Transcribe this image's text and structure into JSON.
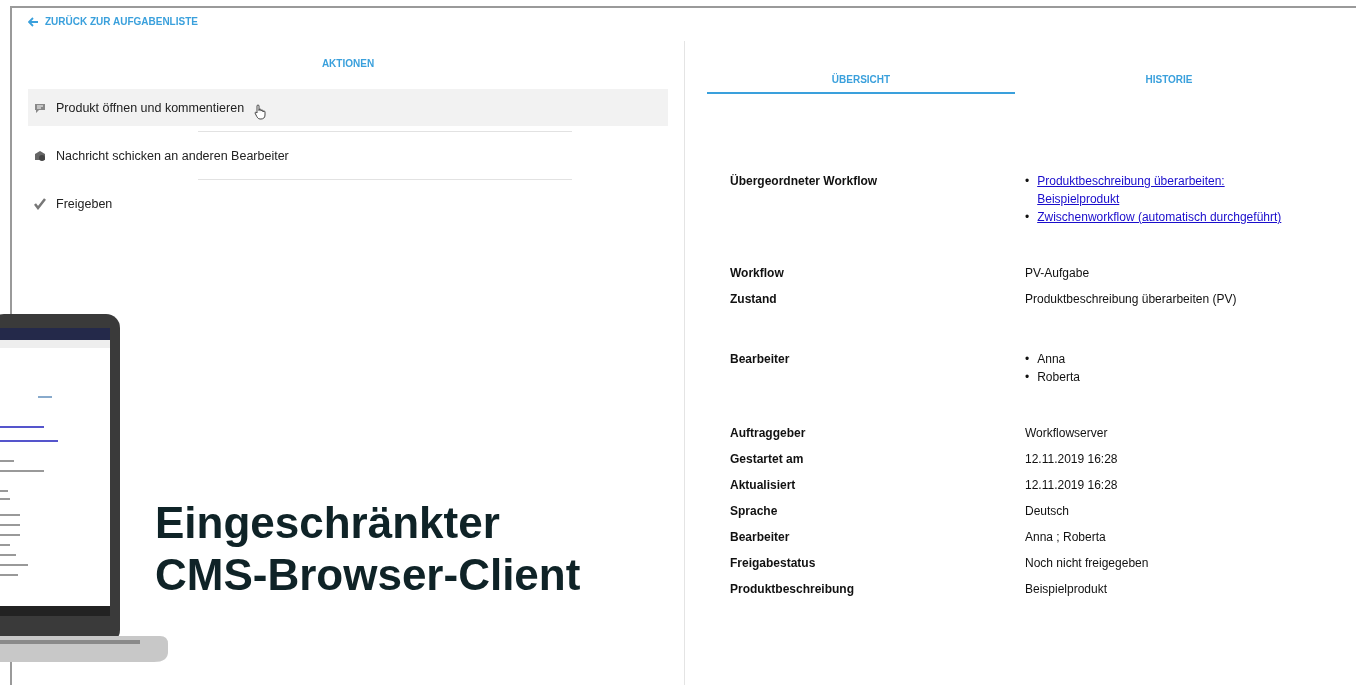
{
  "back_link": {
    "label": "ZURÜCK ZUR AUFGABENLISTE"
  },
  "actions": {
    "title": "AKTIONEN",
    "items": [
      {
        "label": "Produkt öffnen und kommentieren",
        "kind": "comment",
        "highlighted": true
      },
      {
        "label": "Nachricht schicken an anderen Bearbeiter",
        "kind": "message",
        "highlighted": false
      },
      {
        "label": "Freigeben",
        "kind": "approve",
        "highlighted": false
      }
    ]
  },
  "tabs": [
    {
      "label": "ÜBERSICHT",
      "selected": true
    },
    {
      "label": "HISTORIE",
      "selected": false
    }
  ],
  "details": [
    [
      {
        "label": "Übergeordneter Workflow",
        "items": [
          {
            "marker": "•",
            "text": "Produktbeschreibung überarbeiten: Beispielprodukt",
            "link": true
          },
          {
            "marker": "•",
            "text": "Zwischenworkflow (automatisch durchgeführt)",
            "link": true
          }
        ]
      }
    ],
    [
      {
        "label": "Workflow",
        "value": "PV-Aufgabe"
      },
      {
        "label": "Zustand",
        "value": "Produktbeschreibung überarbeiten (PV)"
      }
    ],
    [
      {
        "label": "Bearbeiter",
        "items": [
          {
            "marker": "•",
            "text": "Anna",
            "link": false
          },
          {
            "marker": "•",
            "text": "Roberta",
            "link": false
          }
        ]
      }
    ],
    [
      {
        "label": "Auftraggeber",
        "value": "Workflowserver"
      },
      {
        "label": "Gestartet am",
        "value": "12.11.2019 16:28"
      },
      {
        "label": "Aktualisiert",
        "value": "12.11.2019 16:28"
      },
      {
        "label": "Sprache",
        "value": "Deutsch"
      },
      {
        "label": "Bearbeiter",
        "value": "Anna ; Roberta"
      },
      {
        "label": "Freigabestatus",
        "value": "Noch nicht freigegeben"
      },
      {
        "label": "Produktbeschreibung",
        "value": "Beispielprodukt"
      }
    ]
  ],
  "overlay": {
    "headline_lines": [
      "Eingeschränkter",
      "CMS-Browser-Client"
    ]
  }
}
